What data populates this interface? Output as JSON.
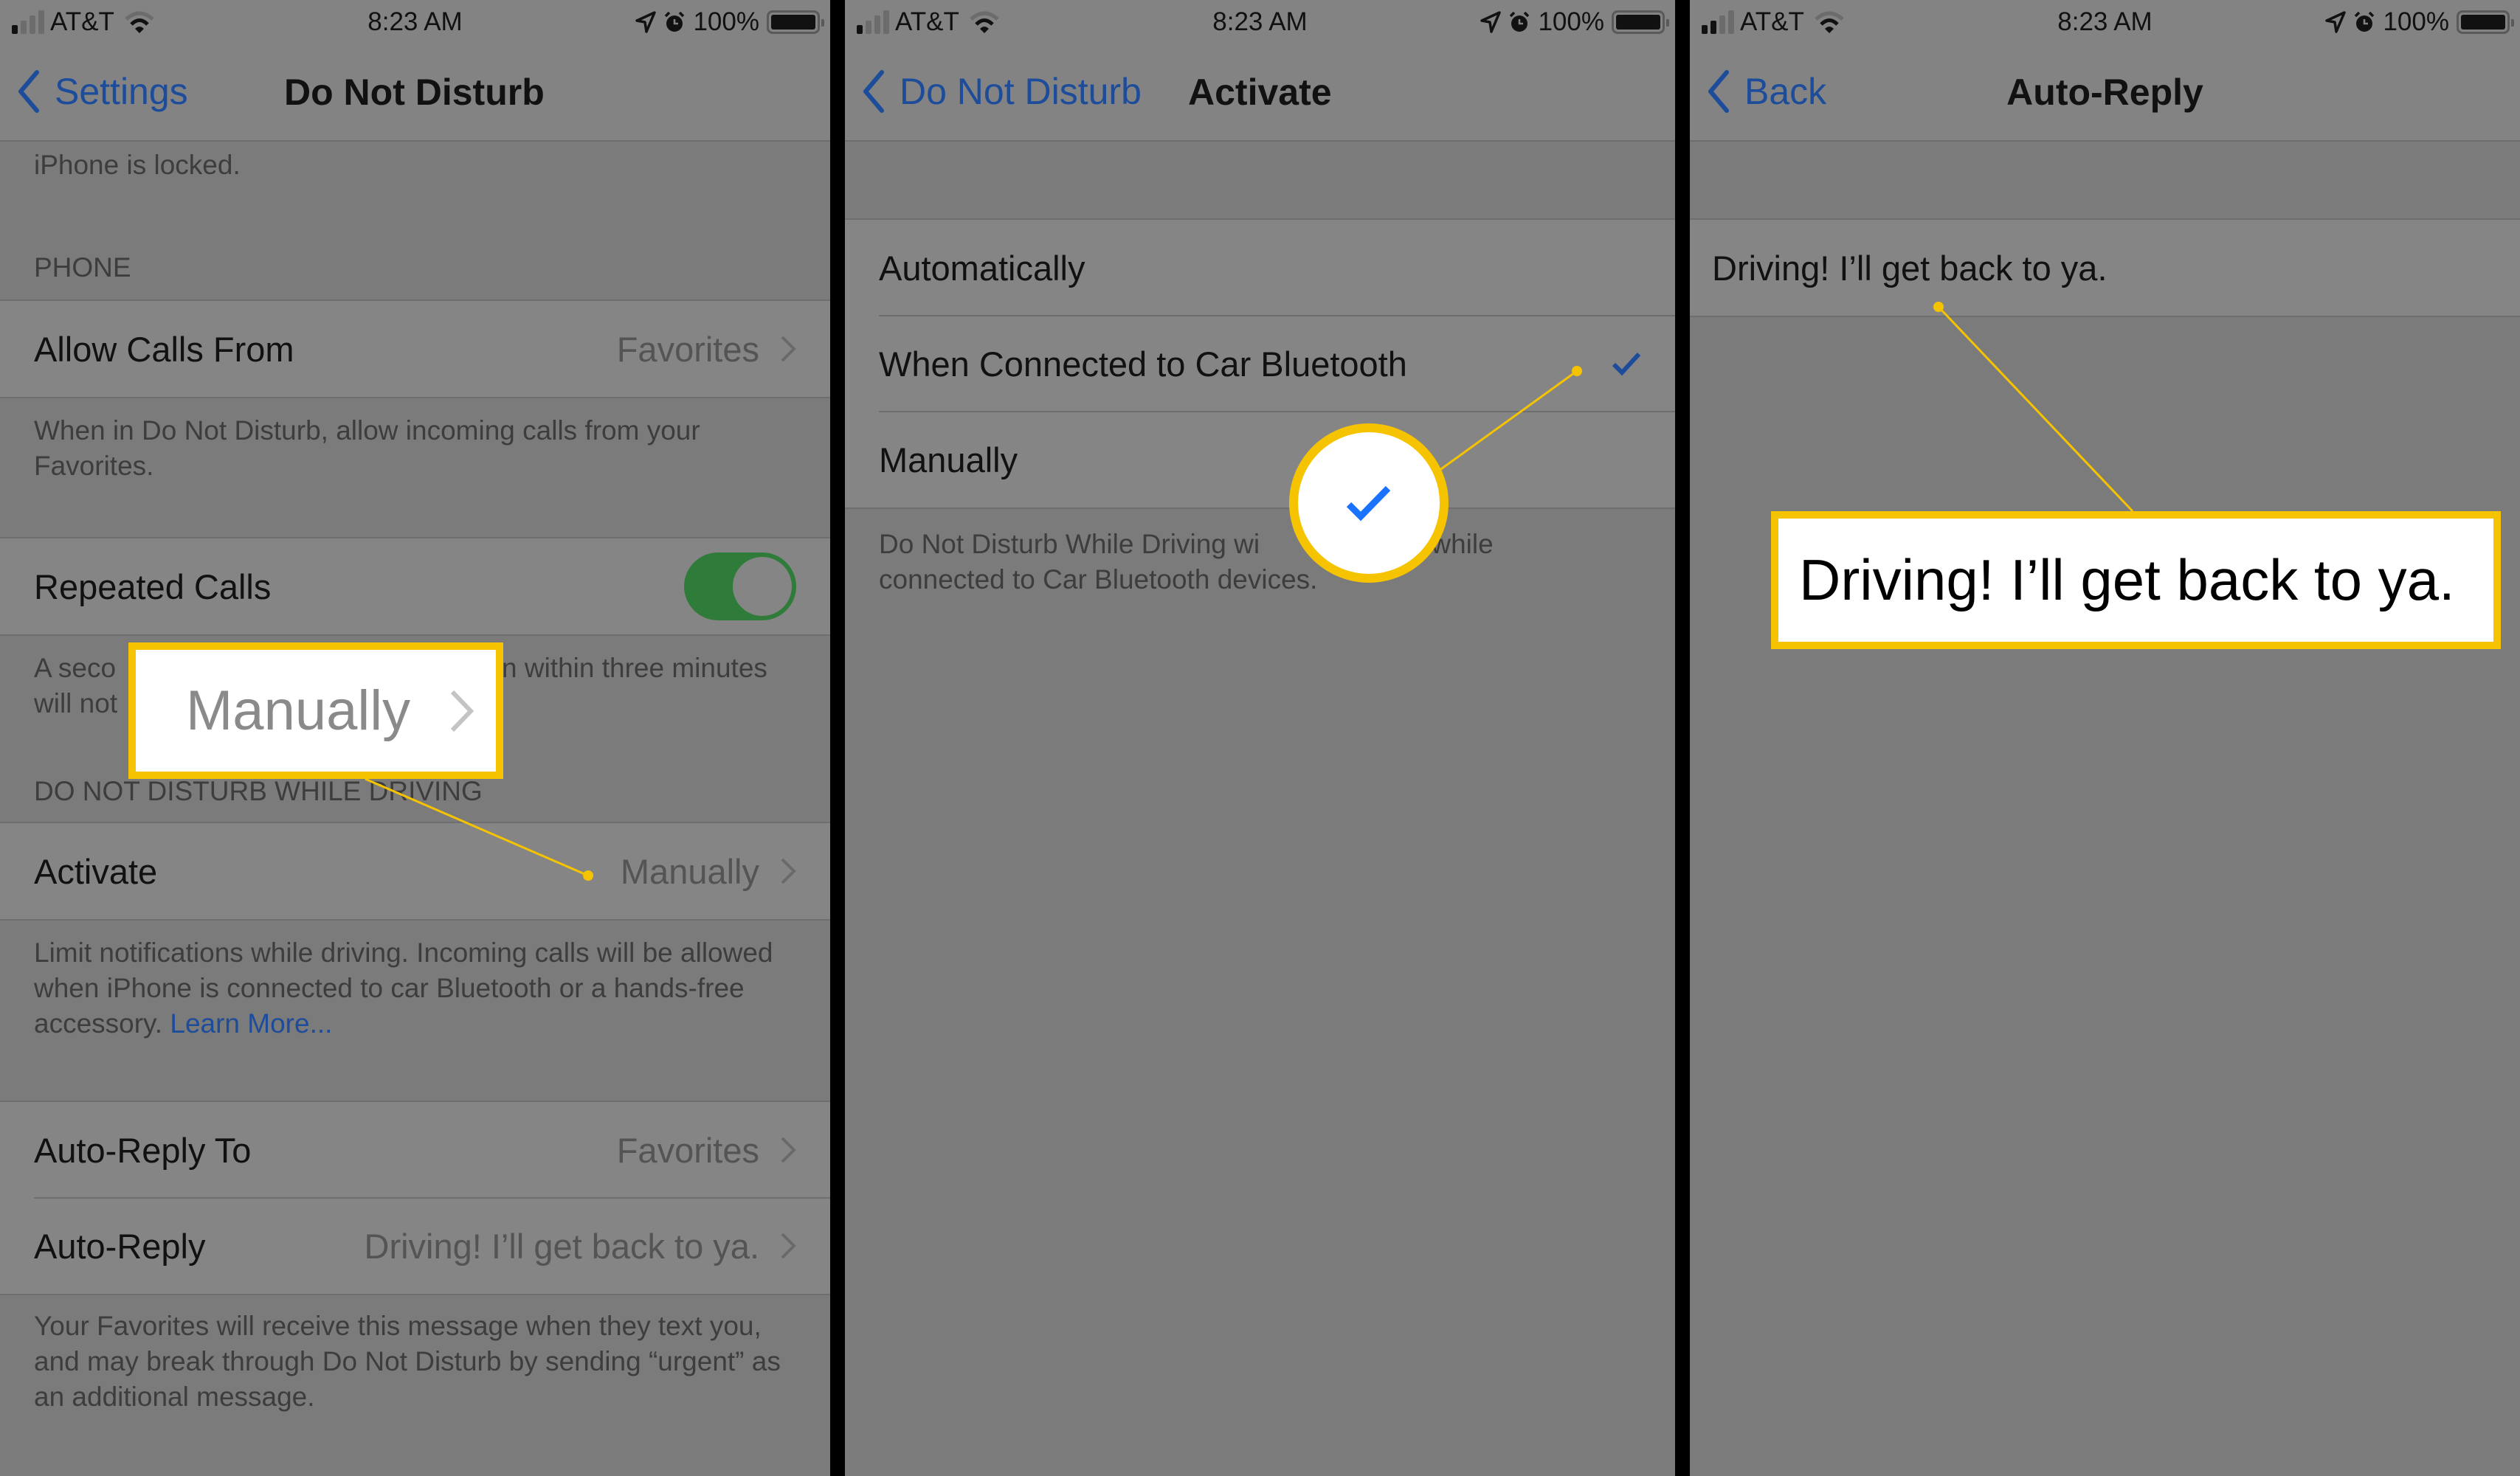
{
  "status_bar": {
    "carrier": "AT&T",
    "time": "8:23 AM",
    "battery_text": "100%",
    "signal_bars_filled": 1,
    "signal_bars_total": 4,
    "wifi_bars_filled": 2,
    "wifi_bars_total": 3,
    "icons": [
      "signal-icon",
      "wifi-icon",
      "location-arrow-icon",
      "alarm-clock-icon",
      "battery-icon"
    ]
  },
  "panels": [
    {
      "nav": {
        "back_label": "Settings",
        "title": "Do Not Disturb"
      },
      "top_footer_partial": "iPhone is locked.",
      "sections": [
        {
          "header": "PHONE",
          "rows": [
            {
              "label": "Allow Calls From",
              "value": "Favorites"
            }
          ],
          "footer": "When in Do Not Disturb, allow incoming calls from your Favorites."
        },
        {
          "rows": [
            {
              "label": "Repeated Calls",
              "toggle_on": true
            }
          ],
          "footer_left_visible": "A seco",
          "footer_left_visible_2": "will not",
          "footer_right_visible": "n within three minutes"
        },
        {
          "header": "DO NOT DISTURB WHILE DRIVING",
          "rows": [
            {
              "label": "Activate",
              "value": "Manually"
            }
          ],
          "footer": "Limit notifications while driving. Incoming calls will be allowed when iPhone is connected to car Bluetooth or a hands-free accessory.",
          "footer_link": "Learn More..."
        },
        {
          "rows": [
            {
              "label": "Auto-Reply To",
              "value": "Favorites"
            },
            {
              "label": "Auto-Reply",
              "value": "Driving! I’ll get back to ya."
            }
          ],
          "footer": "Your Favorites will receive this message when they text you, and may break through Do Not Disturb by sending “urgent” as an additional message."
        }
      ],
      "callout": {
        "text": "Manually"
      }
    },
    {
      "nav": {
        "back_label": "Do Not Disturb",
        "title": "Activate"
      },
      "options": [
        {
          "label": "Automatically",
          "selected": false
        },
        {
          "label": "When Connected to Car Bluetooth",
          "selected": true
        },
        {
          "label": "Manually",
          "selected": false
        }
      ],
      "footer_left_visible": "Do Not Disturb While Driving wi",
      "footer_right_visible": "ated while",
      "footer_line2": "connected to Car Bluetooth devices."
    },
    {
      "nav": {
        "back_label": "Back",
        "title": "Auto-Reply"
      },
      "message": "Driving! I’ll get back to ya.",
      "callout": {
        "text": "Driving! I’ll get back to ya."
      }
    }
  ],
  "colors": {
    "accent_blue": "#1c4c9a",
    "callout_yellow": "#f6c300",
    "toggle_green": "#2e7b3a",
    "check_blue_bright": "#1a73ff"
  }
}
